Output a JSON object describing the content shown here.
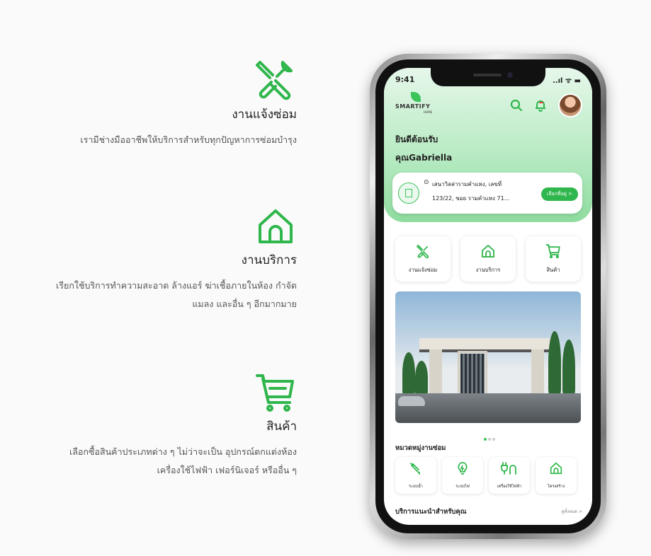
{
  "features": [
    {
      "icon": "tools-icon",
      "title": "งานแจ้งซ่อม",
      "desc": [
        "เรามีช่างมืออาชีพให้บริการสำหรับทุกปัญหาการซ่อมบำรุง"
      ]
    },
    {
      "icon": "house-icon",
      "title": "งานบริการ",
      "desc": [
        "เรียกใช้บริการทำความสะอาด ล้างแอร์ ฆ่าเชื้อภายในห้อง กำจัด",
        "แมลง และอื่น ๆ อีกมากมาย"
      ]
    },
    {
      "icon": "cart-icon",
      "title": "สินค้า",
      "desc": [
        "เลือกซื้อสินค้าประเภทต่าง ๆ ไม่ว่าจะเป็น อุปกรณ์ตกแต่งห้อง",
        "เครื่องใช้ไฟฟ้า เฟอร์นิเจอร์ หรืออื่น ๆ"
      ]
    }
  ],
  "phone": {
    "status_time": "9:41",
    "status_icons": "..ıl ᯤ ▬",
    "logo_text": "SMARTIFY",
    "logo_sub": "HOME",
    "badge": "",
    "greeting_line1": "ยินดีต้อนรับ",
    "greeting_line2": "คุณGabriella",
    "address_line1": "เสนาวิลล่ารามคำแหง, เลขที่",
    "address_line2": "123/22, ซอย รามคำแหง 71...",
    "address_button": "เลือกที่อยู่ >",
    "services": [
      {
        "label": "งานแจ้งซ่อม",
        "icon": "tools-icon"
      },
      {
        "label": "งานบริการ",
        "icon": "house-icon"
      },
      {
        "label": "สินค้า",
        "icon": "cart-icon"
      }
    ],
    "category_title": "หมวดหมู่งานซ่อม",
    "categories": [
      {
        "label": "ระบบน้ำ",
        "icon": "faucet-icon"
      },
      {
        "label": "ระบบไฟ",
        "icon": "bulb-icon"
      },
      {
        "label": "เครื่องใช้ไฟฟ้า",
        "icon": "plug-icon"
      },
      {
        "label": "โครงสร้าง",
        "icon": "house-icon"
      }
    ],
    "recommend_title": "บริการแนะนำสำหรับคุณ",
    "see_all": "ดูทั้งหมด >"
  },
  "colors": {
    "accent": "#2fb64c",
    "hero": "#b9ebc4"
  }
}
